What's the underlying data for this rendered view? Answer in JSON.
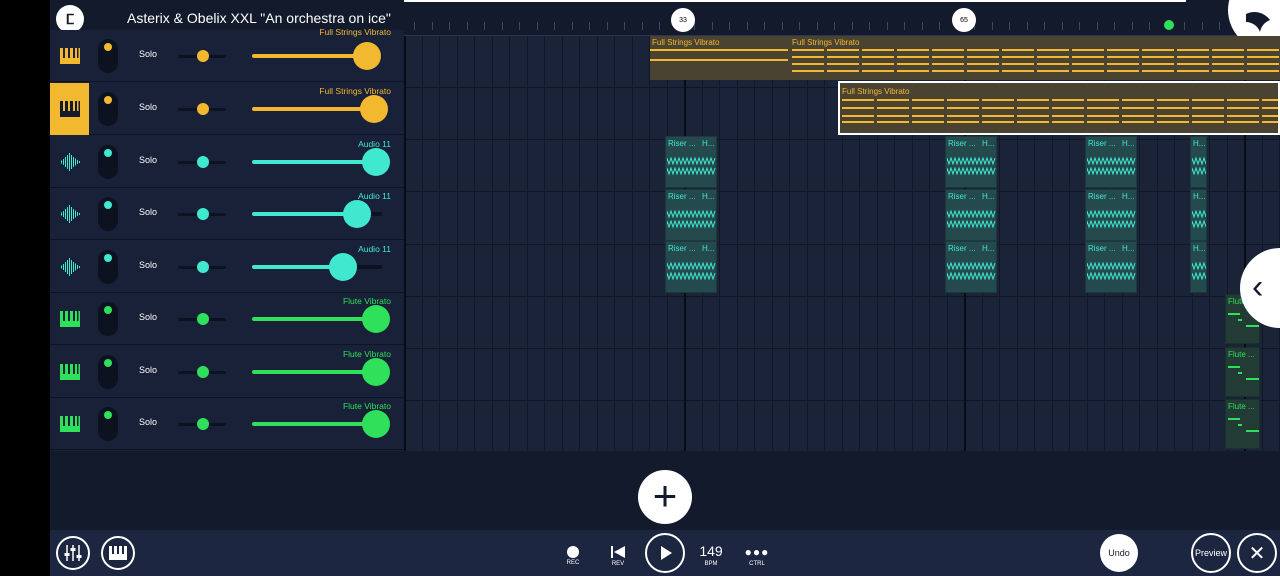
{
  "header": {
    "logo_glyph": "ⵎ",
    "title": "Asterix & Obelix XXL \"An orchestra on ice\"",
    "markers": [
      "33",
      "65"
    ]
  },
  "tracks": [
    {
      "name": "Full Strings Vibrato",
      "solo": "Solo",
      "type": "piano",
      "color": "#f2b830",
      "active": false,
      "volume": 0.92
    },
    {
      "name": "Full Strings Vibrato",
      "solo": "Solo",
      "type": "piano",
      "color": "#f2b830",
      "active": true,
      "volume": 0.98
    },
    {
      "name": "Audio 11",
      "solo": "Solo",
      "type": "audio",
      "color": "#40e8d0",
      "active": false,
      "volume": 1.0
    },
    {
      "name": "Audio 11",
      "solo": "Solo",
      "type": "audio",
      "color": "#40e8d0",
      "active": false,
      "volume": 0.84
    },
    {
      "name": "Audio 11",
      "solo": "Solo",
      "type": "audio",
      "color": "#40e8d0",
      "active": false,
      "volume": 0.72
    },
    {
      "name": "Flute Vibrato",
      "solo": "Solo",
      "type": "piano",
      "color": "#2ee05a",
      "active": false,
      "volume": 1.0
    },
    {
      "name": "Flute Vibrato",
      "solo": "Solo",
      "type": "piano",
      "color": "#2ee05a",
      "active": false,
      "volume": 1.0
    },
    {
      "name": "Flute Vibrato",
      "solo": "Solo",
      "type": "piano",
      "color": "#2ee05a",
      "active": false,
      "volume": 1.0
    }
  ],
  "clips": {
    "strings_top": "Full Strings Vibrato",
    "strings_top2": "Full Strings Vibrato",
    "strings_sel": "Full Strings Vibrato",
    "riser": "Riser ...",
    "h": "H...",
    "flute": "Flute ..."
  },
  "transport": {
    "rec_label": "REC",
    "rev_label": "REV",
    "bpm_value": "149",
    "bpm_label": "BPM",
    "ctrl_label": "CTRL",
    "undo_label": "Undo",
    "preview_label": "Preview",
    "add_glyph": "+",
    "close_glyph": "✕",
    "chevron_glyph": "‹"
  },
  "colors": {
    "background": "#121a2c",
    "strings": "#f2b830",
    "audio": "#40e8d0",
    "flute": "#2ee05a"
  }
}
